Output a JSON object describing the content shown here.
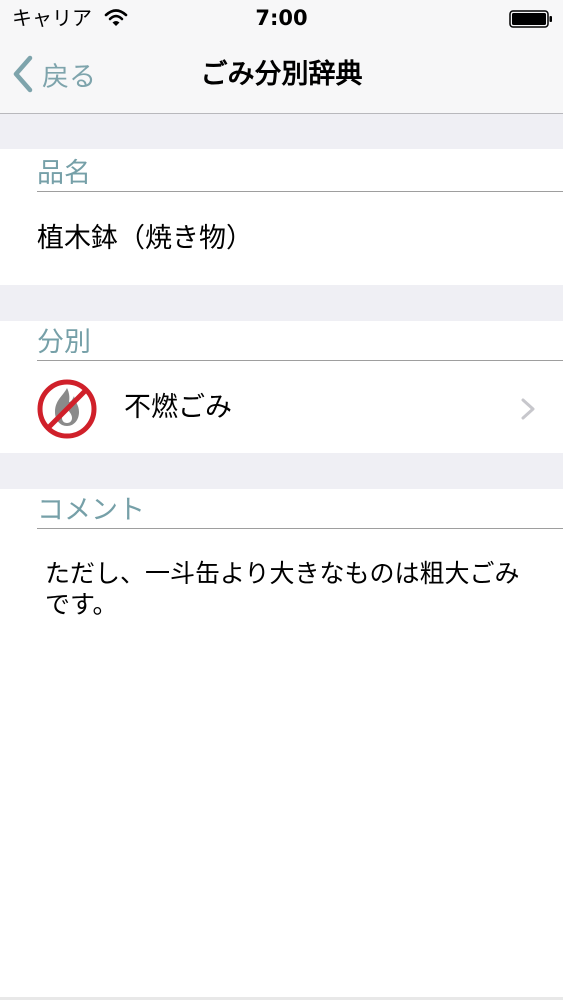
{
  "status_bar": {
    "carrier": "キャリア",
    "time": "7:00"
  },
  "nav": {
    "back_label": "戻る",
    "title": "ごみ分別辞典"
  },
  "sections": {
    "item_name_header": "品名",
    "item_name_value": "植木鉢（焼き物）",
    "category_header": "分別",
    "category_value": "不燃ごみ",
    "category_icon": "no-burn-icon",
    "comment_header": "コメント",
    "comment_value": "ただし、一斗缶より大きなものは粗大ごみです。"
  },
  "colors": {
    "accent": "#76a0a8",
    "icon_red": "#d0202a",
    "icon_gray": "#8a8a8a",
    "gap_background": "#efeff4"
  }
}
